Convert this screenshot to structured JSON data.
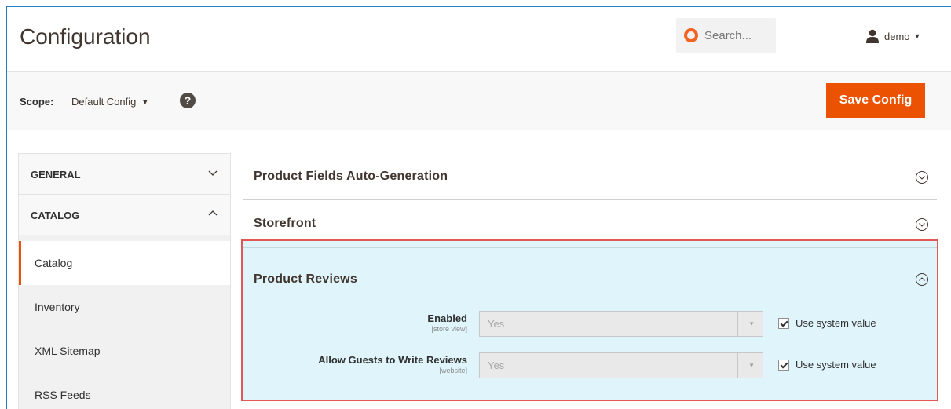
{
  "header": {
    "title": "Configuration",
    "search_placeholder": "Search...",
    "user_name": "demo"
  },
  "scope": {
    "label": "Scope:",
    "value": "Default Config",
    "save_label": "Save Config"
  },
  "sidebar": {
    "groups": [
      {
        "title": "GENERAL",
        "expanded": false
      },
      {
        "title": "CATALOG",
        "expanded": true
      }
    ],
    "items": [
      {
        "label": "Catalog",
        "active": true
      },
      {
        "label": "Inventory",
        "active": false
      },
      {
        "label": "XML Sitemap",
        "active": false
      },
      {
        "label": "RSS Feeds",
        "active": false
      }
    ]
  },
  "sections": [
    {
      "title": "Product Fields Auto-Generation",
      "expanded": false
    },
    {
      "title": "Storefront",
      "expanded": false
    },
    {
      "title": "Product Reviews",
      "expanded": true
    }
  ],
  "fields": [
    {
      "label": "Enabled",
      "scope": "[store view]",
      "value": "Yes",
      "use_system_label": "Use system value",
      "use_system": true
    },
    {
      "label": "Allow Guests to Write Reviews",
      "scope": "[website]",
      "value": "Yes",
      "use_system_label": "Use system value",
      "use_system": true
    }
  ],
  "colors": {
    "accent": "#eb5202",
    "highlight_border": "#e15656",
    "section_bg": "#e0f5fb"
  }
}
